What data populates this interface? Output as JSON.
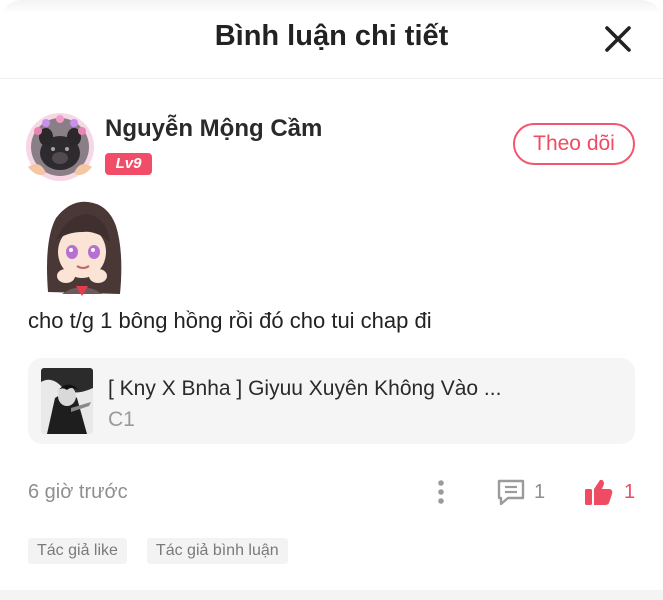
{
  "header": {
    "title": "Bình luận chi tiết",
    "close_icon": "close-icon"
  },
  "comment": {
    "author": "Nguyễn Mộng Cầm",
    "level": "Lv9",
    "follow_label": "Theo dõi",
    "sticker": "anime-girl-sticker",
    "text": "cho t/g 1 bông hồng rồi đó cho tui chap đi",
    "time": "6 giờ trước",
    "reply_count": "1",
    "like_count": "1"
  },
  "story": {
    "title": "[ Kny X Bnha ] Giyuu Xuyên Không Vào ...",
    "chapter": "C1"
  },
  "tags": [
    "Tác giả like",
    "Tác giả bình luận"
  ],
  "colors": {
    "accent": "#ef4b63",
    "badge": "#f24d68",
    "muted": "#8f8f8f",
    "card_bg": "#f5f5f6"
  }
}
